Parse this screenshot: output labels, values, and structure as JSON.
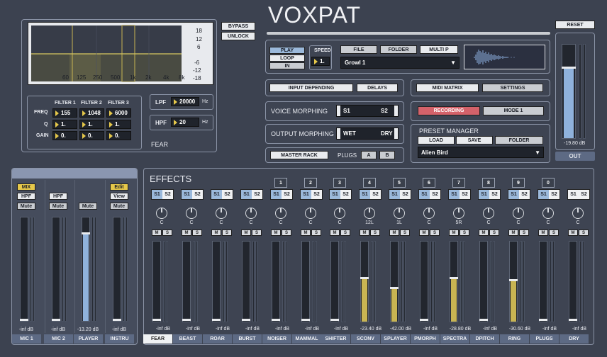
{
  "app": {
    "title": "VOXPAT"
  },
  "colors": {
    "accent": "#e6c84a",
    "selected": "#9bb9db",
    "record": "#d4626a",
    "meter_blue": "#8fb2dc",
    "meter_gold": "#c8b452"
  },
  "eq": {
    "db_labels": [
      "18",
      "12",
      "6",
      "-6",
      "-12",
      "-18"
    ],
    "freq_labels": [
      "60",
      "125",
      "250",
      "500",
      "1k",
      "2k",
      "4k",
      "8k"
    ],
    "filters": {
      "headers": [
        "FILTER 1",
        "FILTER 2",
        "FILTER 3"
      ],
      "rows": [
        {
          "label": "FREQ",
          "values": [
            "155",
            "1048",
            "6000"
          ]
        },
        {
          "label": "Q",
          "values": [
            "1.",
            "1.",
            "1."
          ]
        },
        {
          "label": "GAIN",
          "values": [
            "0.",
            "0.",
            "0."
          ]
        }
      ]
    },
    "lpf": {
      "label": "LPF",
      "value": "20000",
      "unit": "Hz"
    },
    "hpf": {
      "label": "HPF",
      "value": "20",
      "unit": "Hz"
    },
    "preset_name": "FEAR"
  },
  "bypass": {
    "bypass_label": "BYPASS",
    "unlock_label": "UNLOCK"
  },
  "transport": {
    "play": "PLAY",
    "loop": "LOOP",
    "in": "IN",
    "speed_label": "SPEED",
    "speed_value": "1.",
    "file": "FILE",
    "folder": "FOLDER",
    "multi": "MULTI P",
    "sample": "Growl 1"
  },
  "controls": {
    "input_depending": "INPUT DEPENDING",
    "delays": "DELAYS",
    "midi_matrix": "MIDI MATRIX",
    "settings": "SETTINGS",
    "recording": "RECORDING",
    "mode": "MODE 1"
  },
  "morph": {
    "voice_label": "VOICE MORPHING",
    "voice_left": "S1",
    "voice_right": "S2",
    "output_label": "OUTPUT MORPHING",
    "output_left": "WET",
    "output_right": "DRY"
  },
  "rack": {
    "master_rack": "MASTER RACK",
    "plugs": "PLUGS",
    "a": "A",
    "b": "B"
  },
  "preset_manager": {
    "title": "PRESET MANAGER",
    "load": "LOAD",
    "save": "SAVE",
    "folder": "FOLDER",
    "current": "Alien Bird"
  },
  "out": {
    "reset": "RESET",
    "db": "-19.80 dB",
    "label": "OUT",
    "level": 0.83
  },
  "inputs": [
    {
      "name": "MIC 1",
      "top": "MIX",
      "second": "HPF",
      "mute": "Mute",
      "db": "-inf dB",
      "level": 0.0,
      "topYellow": true
    },
    {
      "name": "MIC 2",
      "top": "",
      "second": "HPF",
      "mute": "Mute",
      "db": "-inf dB",
      "level": 0.0,
      "topYellow": false
    },
    {
      "name": "PLAYER",
      "top": "",
      "second": "",
      "mute": "Mute",
      "db": "-13.20 dB",
      "level": 0.85,
      "topYellow": false
    },
    {
      "name": "INSTRU",
      "top": "Edit",
      "second": "View",
      "mute": "Mute",
      "db": "-inf dB",
      "level": 0.0,
      "topYellow": true
    }
  ],
  "effects": {
    "title": "EFFECTS",
    "channels": [
      {
        "name": "FEAR",
        "num": "",
        "pan": "C",
        "db": "-inf dB",
        "level": 0,
        "active": true,
        "s1": true
      },
      {
        "name": "BEAST",
        "num": "",
        "pan": "C",
        "db": "-inf dB",
        "level": 0,
        "active": false,
        "s1": true
      },
      {
        "name": "ROAR",
        "num": "",
        "pan": "C",
        "db": "-inf dB",
        "level": 0,
        "active": false,
        "s1": true
      },
      {
        "name": "BURST",
        "num": "",
        "pan": "C",
        "db": "-inf dB",
        "level": 0,
        "active": false,
        "s1": true
      },
      {
        "name": "NOISER",
        "num": "1",
        "pan": "C",
        "db": "-inf dB",
        "level": 0,
        "active": false,
        "s1": true
      },
      {
        "name": "MAMMAL",
        "num": "2",
        "pan": "C",
        "db": "-inf dB",
        "level": 0,
        "active": false,
        "s1": true
      },
      {
        "name": "SHIFTER",
        "num": "3",
        "pan": "C",
        "db": "-inf dB",
        "level": 0,
        "active": false,
        "s1": true
      },
      {
        "name": "SCONV",
        "num": "4",
        "pan": "12L",
        "db": "-23.40 dB",
        "level": 0.55,
        "active": false,
        "s1": true
      },
      {
        "name": "SPLAYER",
        "num": "5",
        "pan": "1L",
        "db": "-42.00 dB",
        "level": 0.42,
        "active": false,
        "s1": true
      },
      {
        "name": "PMORPH",
        "num": "6",
        "pan": "C",
        "db": "-inf dB",
        "level": 0,
        "active": false,
        "s1": true
      },
      {
        "name": "SPECTRA",
        "num": "7",
        "pan": "5R",
        "db": "-28.80 dB",
        "level": 0.55,
        "active": false,
        "s1": true
      },
      {
        "name": "DPITCH",
        "num": "8",
        "pan": "C",
        "db": "-inf dB",
        "level": 0,
        "active": false,
        "s1": true
      },
      {
        "name": "RING",
        "num": "9",
        "pan": "C",
        "db": "-30.60 dB",
        "level": 0.52,
        "active": false,
        "s1": true
      },
      {
        "name": "PLUGS",
        "num": "0",
        "pan": "C",
        "db": "-inf dB",
        "level": 0,
        "active": false,
        "s1": true
      },
      {
        "name": "DRY",
        "num": "",
        "pan": "C",
        "db": "-inf dB",
        "level": 0,
        "active": false,
        "s1": false
      }
    ],
    "s1_label": "S1",
    "s2_label": "S2",
    "m_label": "M",
    "s_label": "S"
  }
}
